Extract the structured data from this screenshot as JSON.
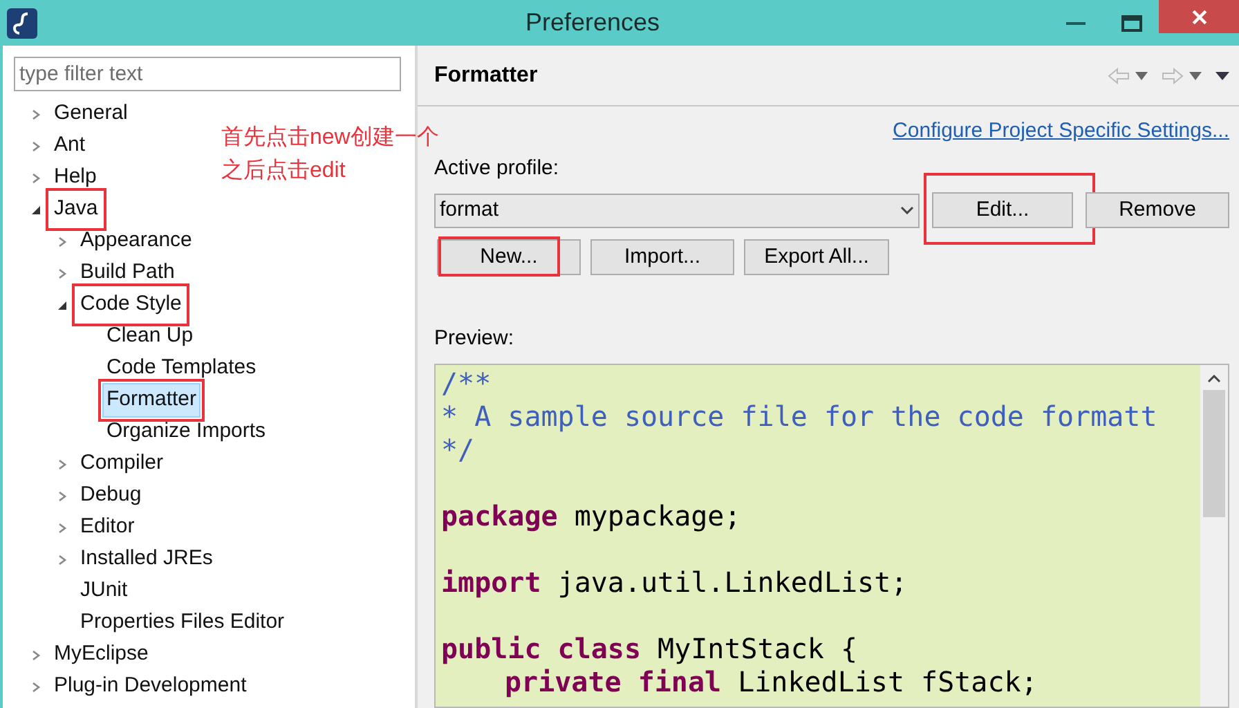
{
  "window": {
    "title": "Preferences"
  },
  "filter": {
    "placeholder": "type filter text"
  },
  "tree": [
    {
      "label": "General",
      "expanded": false,
      "selected": false,
      "annotated": false
    },
    {
      "label": "Ant",
      "expanded": false,
      "selected": false,
      "annotated": false
    },
    {
      "label": "Help",
      "expanded": false,
      "selected": false,
      "annotated": false
    },
    {
      "label": "Java",
      "expanded": true,
      "selected": false,
      "annotated": true,
      "children": [
        {
          "label": "Appearance",
          "expanded": false,
          "selected": false,
          "annotated": false
        },
        {
          "label": "Build Path",
          "expanded": false,
          "selected": false,
          "annotated": false
        },
        {
          "label": "Code Style",
          "expanded": true,
          "selected": false,
          "annotated": true,
          "children": [
            {
              "label": "Clean Up",
              "selected": false,
              "annotated": false
            },
            {
              "label": "Code Templates",
              "selected": false,
              "annotated": false
            },
            {
              "label": "Formatter",
              "selected": true,
              "annotated": true
            },
            {
              "label": "Organize Imports",
              "selected": false,
              "annotated": false
            }
          ]
        },
        {
          "label": "Compiler",
          "expanded": false,
          "selected": false,
          "annotated": false
        },
        {
          "label": "Debug",
          "expanded": false,
          "selected": false,
          "annotated": false
        },
        {
          "label": "Editor",
          "expanded": false,
          "selected": false,
          "annotated": false
        },
        {
          "label": "Installed JREs",
          "expanded": false,
          "selected": false,
          "annotated": false
        },
        {
          "label": "JUnit",
          "selected": false,
          "annotated": false
        },
        {
          "label": "Properties Files Editor",
          "selected": false,
          "annotated": false
        }
      ]
    },
    {
      "label": "MyEclipse",
      "expanded": false,
      "selected": false,
      "annotated": false
    },
    {
      "label": "Plug-in Development",
      "expanded": false,
      "selected": false,
      "annotated": false
    }
  ],
  "annotation_notes": [
    "首先点击new创建一个",
    "之后点击edit"
  ],
  "page": {
    "title": "Formatter",
    "link": "Configure Project Specific Settings...",
    "profile_label": "Active profile:",
    "profile_value": "format",
    "buttons_row1": [
      {
        "label": "Edit...",
        "annotated": true
      },
      {
        "label": "Remove",
        "annotated": false
      }
    ],
    "buttons_row2": [
      {
        "label": "New...",
        "annotated": true
      },
      {
        "label": "Import...",
        "annotated": false
      },
      {
        "label": "Export All...",
        "annotated": false
      }
    ],
    "preview_label": "Preview:",
    "code_blocks": [
      [
        {
          "indent": false,
          "tokens": [
            {
              "kind": "comment",
              "text": "/**"
            }
          ]
        },
        {
          "indent": false,
          "tokens": [
            {
              "kind": "comment",
              "text": "* A sample source file for the code formatt"
            }
          ]
        },
        {
          "indent": false,
          "tokens": [
            {
              "kind": "comment",
              "text": "*/"
            }
          ]
        }
      ],
      [
        {
          "indent": false,
          "tokens": [
            {
              "kind": "keyword",
              "text": "package"
            },
            {
              "kind": "plain",
              "text": " mypackage;"
            }
          ]
        }
      ],
      [
        {
          "indent": false,
          "tokens": [
            {
              "kind": "keyword",
              "text": "import"
            },
            {
              "kind": "plain",
              "text": " java.util.LinkedList;"
            }
          ]
        }
      ],
      [
        {
          "indent": false,
          "tokens": [
            {
              "kind": "keyword",
              "text": "public class"
            },
            {
              "kind": "plain",
              "text": " MyIntStack {"
            }
          ]
        },
        {
          "indent": true,
          "tokens": [
            {
              "kind": "keyword",
              "text": "private final"
            },
            {
              "kind": "plain",
              "text": " LinkedList fStack;"
            }
          ]
        }
      ]
    ]
  }
}
